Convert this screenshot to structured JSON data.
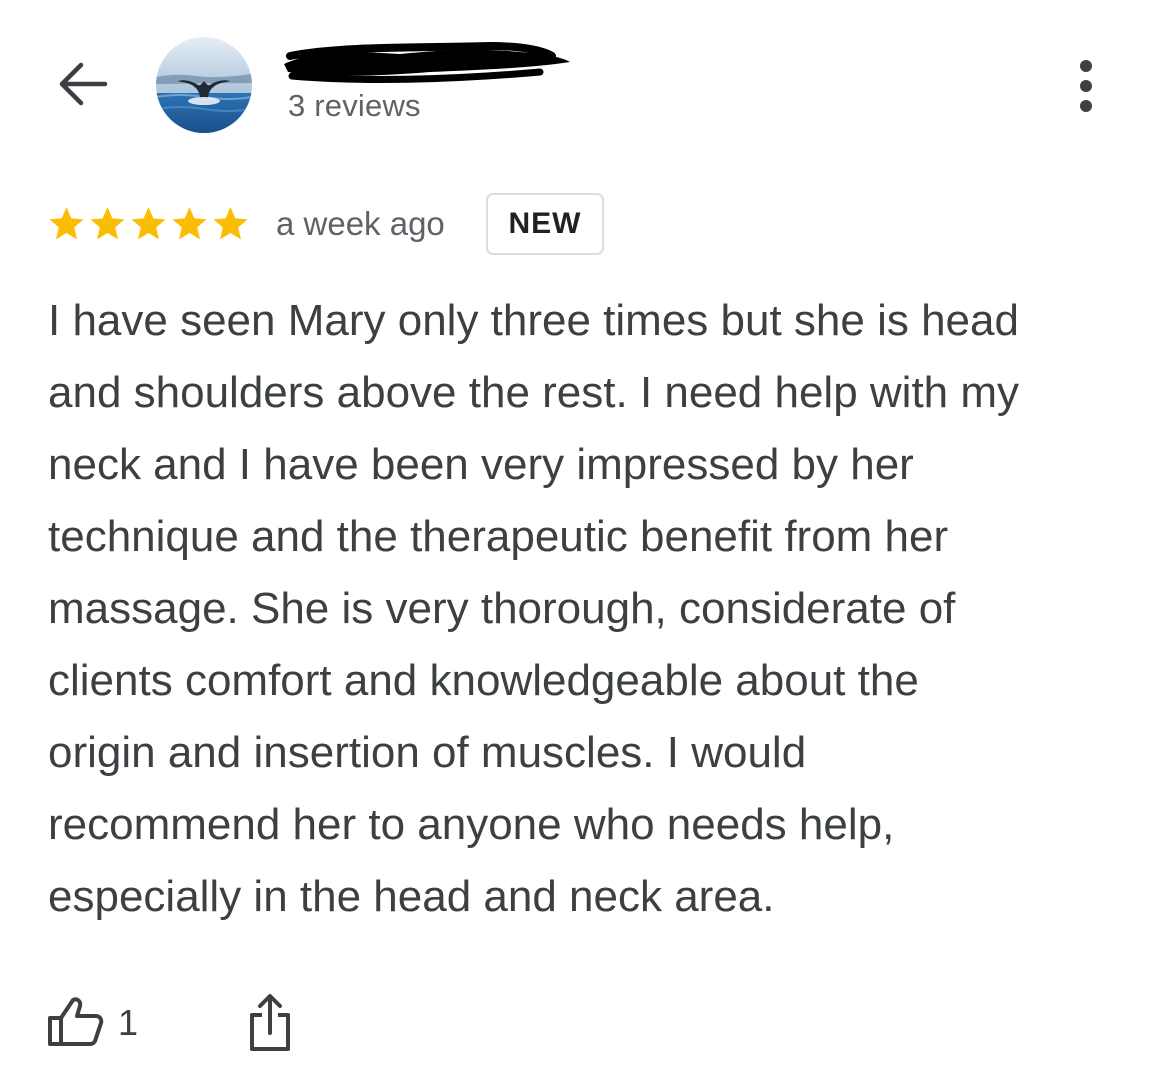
{
  "header": {
    "back_icon": "arrow-back-icon",
    "avatar_icon": "whale-tail-photo",
    "reviewer_name_redacted": true,
    "review_count": "3 reviews",
    "more_icon": "more-vert-icon"
  },
  "review": {
    "rating": 5,
    "rating_max": 5,
    "star_color": "#fbbc04",
    "timestamp": "a week ago",
    "badge": "NEW",
    "text_lines": [
      "I have seen Mary only three times but she is head",
      "and shoulders above the rest. I need help with my",
      "neck and I have been very impressed by her",
      "technique and the therapeutic benefit from her",
      "massage. She is very thorough, considerate of",
      "clients comfort and knowledgeable about the",
      "origin and insertion of muscles. I would",
      "recommend her to anyone who needs help,",
      "especially in the head and neck area."
    ]
  },
  "actions": {
    "like_icon": "thumb-up-icon",
    "like_count": "1",
    "share_icon": "share-icon"
  }
}
